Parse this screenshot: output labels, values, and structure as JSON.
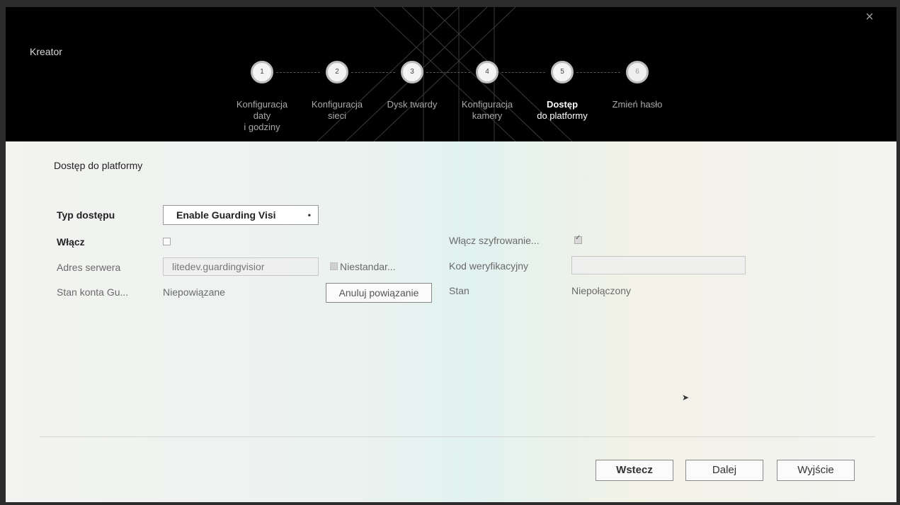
{
  "header": {
    "title": "Kreator",
    "close_icon": "×"
  },
  "steps": [
    {
      "number": "1",
      "label_lines": [
        "Konfiguracja",
        "daty",
        "i godziny"
      ],
      "active": false
    },
    {
      "number": "2",
      "label_lines": [
        "Konfiguracja",
        "sieci"
      ],
      "active": false
    },
    {
      "number": "3",
      "label_lines": [
        "Dysk twardy"
      ],
      "active": false
    },
    {
      "number": "4",
      "label_lines": [
        "Konfiguracja",
        "kamery"
      ],
      "active": false
    },
    {
      "number": "5",
      "label_lines": [
        "Dostęp",
        "do platformy"
      ],
      "active": true
    },
    {
      "number": "6",
      "label_lines": [
        "Zmień hasło"
      ],
      "active": false
    }
  ],
  "section": {
    "title": "Dostęp do platformy"
  },
  "form": {
    "access_type_label": "Typ dostępu",
    "access_type_value": "Enable Guarding Visi",
    "enable_label": "Włącz",
    "enable_checked": false,
    "encryption_label": "Włącz szyfrowanie...",
    "encryption_checked": true,
    "server_address_label": "Adres serwera",
    "server_address_value": "litedev.guardingvisior",
    "custom_label": "Niestandar...",
    "custom_checked": false,
    "verification_code_label": "Kod weryfikacyjny",
    "verification_code_value": "",
    "account_state_label": "Stan konta Gu...",
    "account_state_value": "Niepowiązane",
    "unbind_button": "Anuluj powiązanie",
    "status_label": "Stan",
    "status_value": "Niepołączony"
  },
  "footer": {
    "back": "Wstecz",
    "next": "Dalej",
    "exit": "Wyjście"
  }
}
